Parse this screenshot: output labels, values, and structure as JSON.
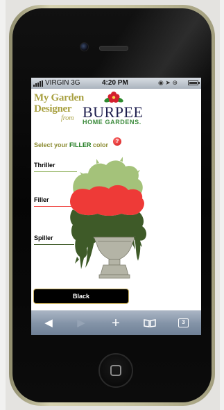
{
  "status_bar": {
    "carrier": "VIRGIN 3G",
    "time": "4:20 PM"
  },
  "header": {
    "app_name_line1": "My Garden",
    "app_name_line2": "Designer",
    "app_name_from": "from",
    "brand_name": "BURPEE",
    "brand_tagline": "HOME GARDENS."
  },
  "instruction": {
    "prefix": "Select your ",
    "highlight": "FILLER",
    "suffix": " color",
    "help_glyph": "?"
  },
  "planter": {
    "labels": {
      "thriller": "Thriller",
      "filler": "Filler",
      "spiller": "Spiller"
    },
    "colors": {
      "thriller": "#a4c27a",
      "filler": "#ee3a37",
      "spiller": "#3e5a28",
      "urn": "#b4b4a6"
    }
  },
  "color_button": {
    "label": "Black"
  },
  "toolbar": {
    "back_icon": "back-arrow-icon",
    "forward_icon": "forward-arrow-icon",
    "add_icon": "plus-icon",
    "bookmarks_icon": "book-icon",
    "tabs_count": "3"
  }
}
